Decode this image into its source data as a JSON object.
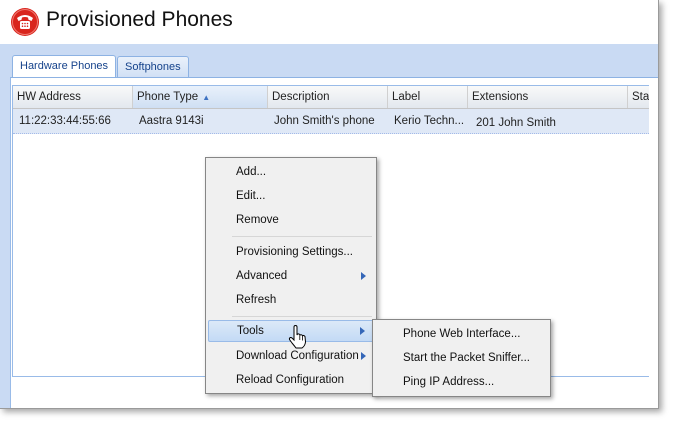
{
  "app": {
    "title": "Provisioned Phones"
  },
  "colors": {
    "accent": "#15428b",
    "panel": "#c9daf3",
    "row_selected": "#dfe8f6",
    "icon_red": "#d9251d"
  },
  "tabs": [
    {
      "label": "Hardware Phones",
      "active": true
    },
    {
      "label": "Softphones",
      "active": false
    }
  ],
  "grid": {
    "columns": [
      {
        "label": "HW Address"
      },
      {
        "label": "Phone Type",
        "sorted": "asc"
      },
      {
        "label": "Description"
      },
      {
        "label": "Label"
      },
      {
        "label": "Extensions"
      },
      {
        "label": "Sta"
      }
    ],
    "rows": [
      {
        "hw_address": "11:22:33:44:55:66",
        "phone_type": "Aastra 9143i",
        "description": "John Smith's phone",
        "label": "Kerio Techn...",
        "extensions": "201 John Smith"
      }
    ]
  },
  "context_menu": {
    "items": [
      {
        "label": "Add..."
      },
      {
        "label": "Edit..."
      },
      {
        "label": "Remove"
      },
      {
        "label": "Provisioning Settings..."
      },
      {
        "label": "Advanced",
        "submenu": true
      },
      {
        "label": "Refresh"
      },
      {
        "label": "Tools",
        "submenu": true,
        "hover": true
      },
      {
        "label": "Download Configuration",
        "submenu": true
      },
      {
        "label": "Reload Configuration"
      }
    ]
  },
  "tools_submenu": {
    "items": [
      {
        "label": "Phone Web Interface..."
      },
      {
        "label": "Start the Packet Sniffer..."
      },
      {
        "label": "Ping IP Address..."
      }
    ]
  },
  "icons": {
    "app_icon": "telephone-icon",
    "cursor": "hand-pointer-icon"
  }
}
